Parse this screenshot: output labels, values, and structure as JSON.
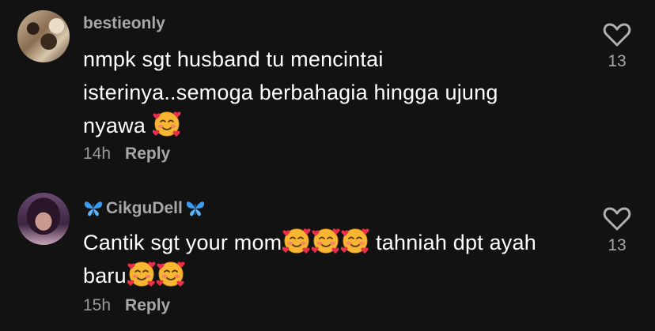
{
  "comments": [
    {
      "username": "bestieonly",
      "text_lines": [
        "nmpk sgt husband tu mencintai",
        "isterinya..semoga berbahagia hingga ujung",
        "nyawa"
      ],
      "emoji_name": "smiling-face-with-hearts",
      "time": "14h",
      "reply_label": "Reply",
      "likes": "13"
    },
    {
      "username": "CikguDell",
      "username_decoration": "butterfly",
      "text_line1_a": "Cantik sgt your mom",
      "text_line1_b": " tahniah dpt ayah",
      "text_line2": "baru",
      "emoji_name": "smiling-face-with-hearts",
      "time": "15h",
      "reply_label": "Reply",
      "likes": "13"
    }
  ],
  "colors": {
    "background": "#121212",
    "username": "#a8a8a8",
    "text": "#ffffff",
    "meta": "#9a9a9a",
    "butterfly": "#3a9cf0",
    "emoji_face": "#f7b733",
    "emoji_heart": "#e8304a"
  }
}
